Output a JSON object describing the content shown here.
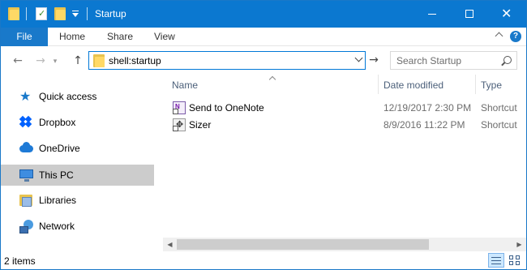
{
  "window": {
    "title": "Startup"
  },
  "titlebar": {
    "quick_access_icons": [
      "folder-icon",
      "properties-icon",
      "new-folder-icon",
      "customize-dropdown-icon"
    ],
    "buttons": [
      "minimize",
      "maximize",
      "close"
    ],
    "accent_color": "#0b78d0"
  },
  "ribbon": {
    "tabs": [
      {
        "label": "File",
        "active": true
      },
      {
        "label": "Home"
      },
      {
        "label": "Share"
      },
      {
        "label": "View"
      }
    ],
    "help_icon_text": "?"
  },
  "address": {
    "path": "shell:startup",
    "search_placeholder": "Search Startup"
  },
  "nav": {
    "items": [
      {
        "label": "Quick access",
        "icon": "star-icon"
      },
      {
        "label": "Dropbox",
        "icon": "dropbox-icon"
      },
      {
        "label": "OneDrive",
        "icon": "onedrive-icon"
      },
      {
        "label": "This PC",
        "icon": "this-pc-icon",
        "selected": true
      },
      {
        "label": "Libraries",
        "icon": "libraries-icon"
      },
      {
        "label": "Network",
        "icon": "network-icon"
      }
    ]
  },
  "list": {
    "columns": [
      "Name",
      "Date modified",
      "Type"
    ],
    "sorted_by": "Name",
    "rows": [
      {
        "name": "Send to OneNote",
        "date": "12/19/2017 2:30 PM",
        "type": "Shortcut",
        "icon": "onenote-shortcut-icon",
        "icon_text": "N"
      },
      {
        "name": "Sizer",
        "date": "8/9/2016 11:22 PM",
        "type": "Shortcut",
        "icon": "sizer-shortcut-icon",
        "icon_text": "✥"
      }
    ]
  },
  "status": {
    "items_text": "2 items",
    "view_mode": "details"
  }
}
